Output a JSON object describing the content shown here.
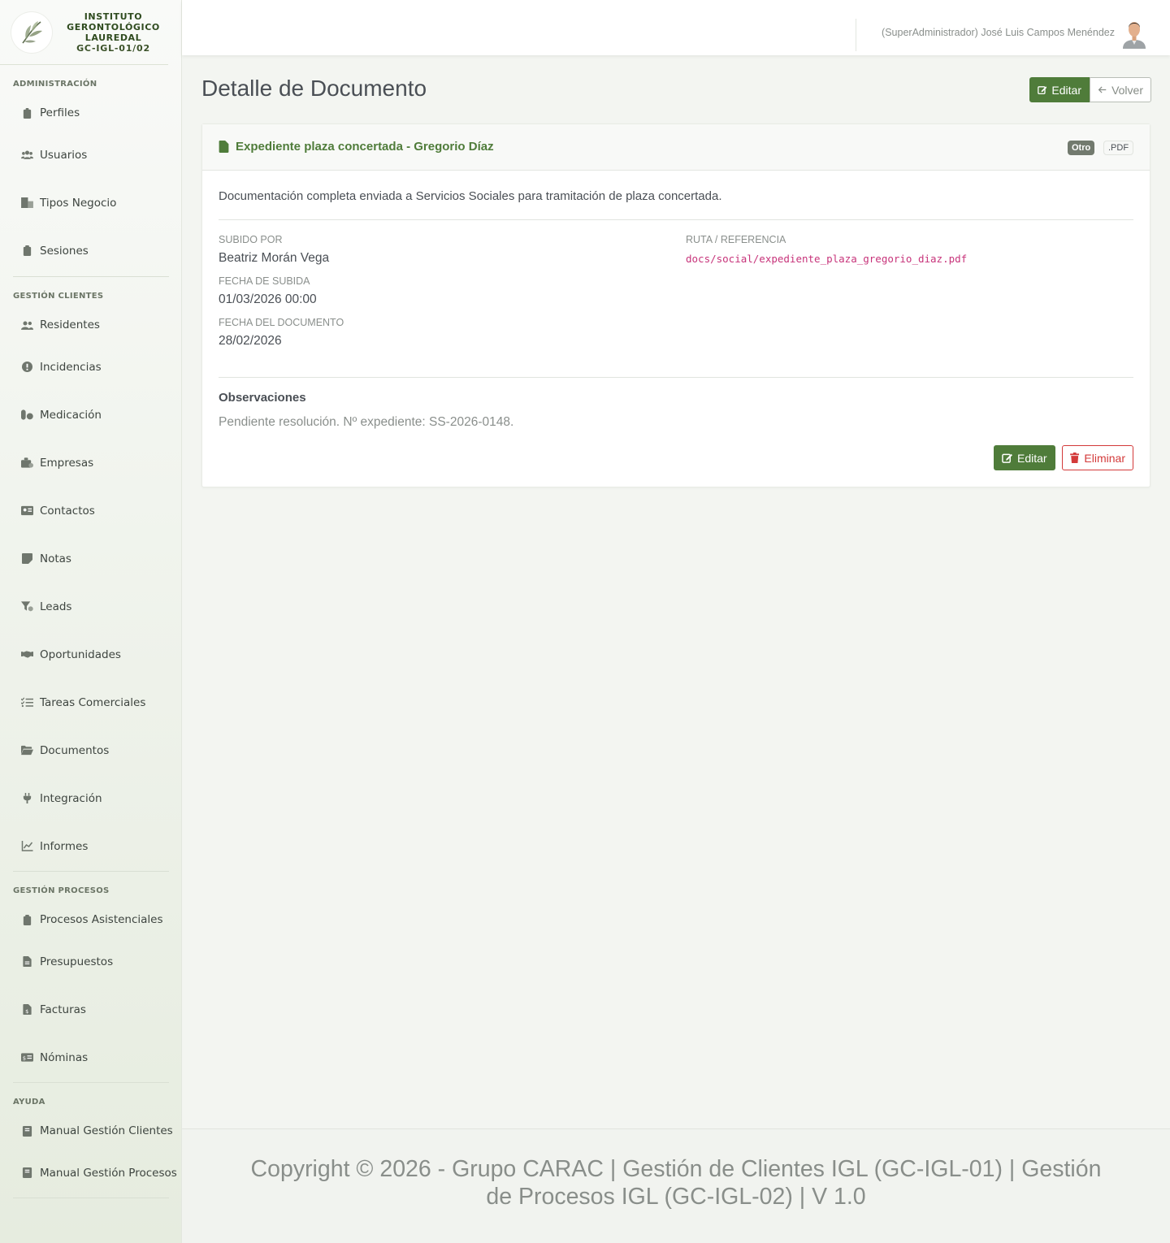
{
  "brand": {
    "line1": "INSTITUTO",
    "line2": "GERONTOLÓGICO",
    "line3": "LAUREDAL",
    "code": "GC-IGL-01/02"
  },
  "sidebar": {
    "sections": [
      {
        "title": "ADMINISTRACIÓN",
        "items": [
          {
            "label": "Perfiles",
            "icon": "id-badge-icon"
          },
          {
            "label": "Usuarios",
            "icon": "users-icon"
          },
          {
            "label": "Tipos Negocio",
            "icon": "building-icon"
          },
          {
            "label": "Sesiones",
            "icon": "clipboard-icon"
          }
        ]
      },
      {
        "title": "GESTIÓN CLIENTES",
        "items": [
          {
            "label": "Residentes",
            "icon": "user-group-icon"
          },
          {
            "label": "Incidencias",
            "icon": "exclamation-circle-icon"
          },
          {
            "label": "Medicación",
            "icon": "pills-icon"
          },
          {
            "label": "Empresas",
            "icon": "briefcase-icon"
          },
          {
            "label": "Contactos",
            "icon": "address-card-icon"
          },
          {
            "label": "Notas",
            "icon": "sticky-note-icon"
          },
          {
            "label": "Leads",
            "icon": "funnel-icon"
          },
          {
            "label": "Oportunidades",
            "icon": "handshake-icon"
          },
          {
            "label": "Tareas Comerciales",
            "icon": "list-check-icon"
          },
          {
            "label": "Documentos",
            "icon": "folder-open-icon"
          },
          {
            "label": "Integración",
            "icon": "plug-icon"
          },
          {
            "label": "Informes",
            "icon": "chart-line-icon"
          }
        ]
      },
      {
        "title": "GESTIÓN PROCESOS",
        "items": [
          {
            "label": "Procesos Asistenciales",
            "icon": "clipboard-icon"
          },
          {
            "label": "Presupuestos",
            "icon": "file-lines-icon"
          },
          {
            "label": "Facturas",
            "icon": "file-invoice-dollar-icon"
          },
          {
            "label": "Nóminas",
            "icon": "money-check-icon"
          }
        ]
      },
      {
        "title": "AYUDA",
        "items": [
          {
            "label": "Manual Gestión Clientes",
            "icon": "book-icon"
          },
          {
            "label": "Manual Gestión Procesos",
            "icon": "book-icon"
          }
        ]
      }
    ]
  },
  "topbar": {
    "user": "(SuperAdministrador) José Luis Campos Menéndez"
  },
  "page": {
    "title": "Detalle de Documento",
    "edit_label": "Editar",
    "back_label": "Volver"
  },
  "document": {
    "title": "Expediente plaza concertada - Gregorio Díaz",
    "type_badge": "Otro",
    "ext_badge": ".PDF",
    "description": "Documentación completa enviada a Servicios Sociales para tramitación de plaza concertada.",
    "uploaded_by_label": "SUBIDO POR",
    "uploaded_by": "Beatriz Morán Vega",
    "upload_date_label": "FECHA DE SUBIDA",
    "upload_date": "01/03/2026 00:00",
    "doc_date_label": "FECHA DEL DOCUMENTO",
    "doc_date": "28/02/2026",
    "path_label": "RUTA / REFERENCIA",
    "path": "docs/social/expediente_plaza_gregorio_diaz.pdf",
    "observations_title": "Observaciones",
    "observations": "Pendiente resolución. Nº expediente: SS-2026-0148.",
    "edit_label": "Editar",
    "delete_label": "Eliminar"
  },
  "footer": {
    "text": "Copyright © 2026 - Grupo CARAC | Gestión de Clientes IGL (GC-IGL-01) | Gestión de Procesos IGL (GC-IGL-02) | V 1.0"
  },
  "colors": {
    "accent": "#4f7c3a",
    "danger": "#d33a3a",
    "code": "#c7337a"
  }
}
